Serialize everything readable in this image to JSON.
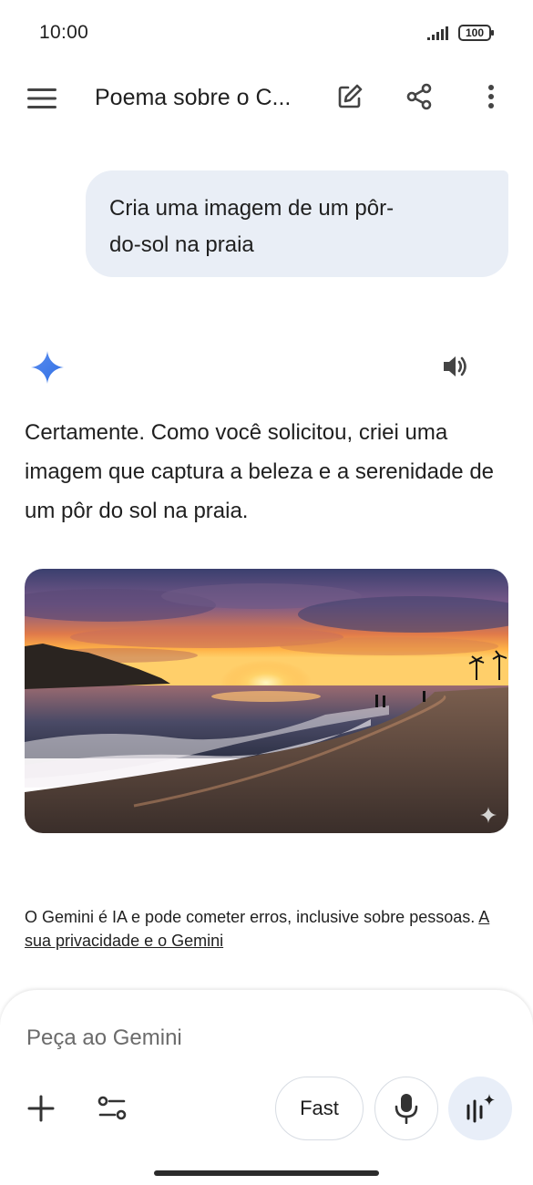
{
  "status_bar": {
    "time": "10:00",
    "battery": "100"
  },
  "header": {
    "title": "Poema sobre o C..."
  },
  "chat": {
    "user_prompt": "Cria uma imagem de um pôr-do-sol na praia",
    "response_text": "Certamente. Como você solicitou, criei uma imagem que captura a beleza e a serenidade de um pôr do sol na praia."
  },
  "disclaimer": {
    "text": "O Gemini é IA e pode cometer erros, inclusive sobre pessoas.",
    "link": "A sua privacidade e o Gemini"
  },
  "composer": {
    "placeholder": "Peça ao Gemini",
    "mode_label": "Fast"
  },
  "icons": {
    "menu": "menu-icon",
    "edit": "edit-icon",
    "share": "share-icon",
    "more": "more-vert-icon",
    "gemini": "gemini-spark-icon",
    "speaker": "volume-icon",
    "add": "plus-icon",
    "tools": "tools-icon",
    "mic": "mic-icon",
    "live": "live-icon"
  },
  "colors": {
    "bubble": "#e9eef6",
    "accent": "#4285f4",
    "live_bg": "#e8eef8"
  }
}
